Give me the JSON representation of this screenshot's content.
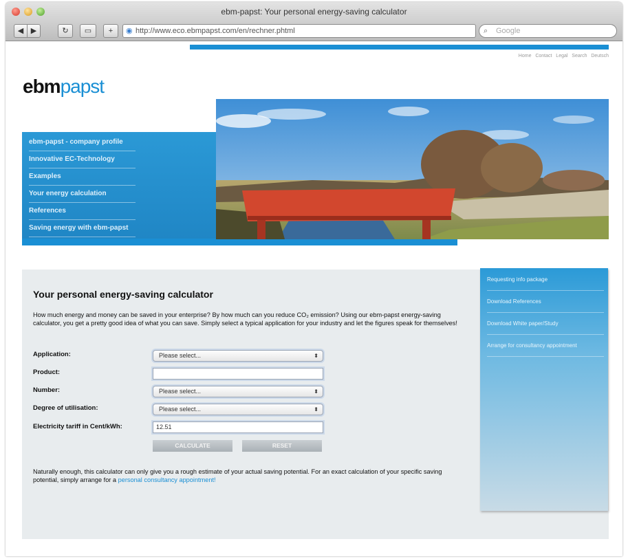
{
  "browser": {
    "title": "ebm-papst: Your personal energy-saving calculator",
    "url": "http://www.eco.ebmpapst.com/en/rechner.phtml",
    "search_placeholder": "Google",
    "back": "◀",
    "forward": "▶",
    "reload": "↻",
    "view": "▭",
    "add": "+",
    "url_icon": "globe-icon",
    "search_icon": "magnifier-icon"
  },
  "meta_links": [
    "Home",
    "Contact",
    "Legal",
    "Search",
    "Deutsch"
  ],
  "logo": {
    "part1": "ebm",
    "part2": "papst"
  },
  "nav": {
    "items": [
      "ebm-papst - company profile",
      "Innovative EC-Technology",
      "Examples",
      "Your energy calculation",
      "References",
      "Saving energy with ebm-papst"
    ]
  },
  "calculator": {
    "title": "Your personal energy-saving calculator",
    "intro": "How much energy and money can be saved in your enterprise? By how much can you reduce CO₂ emission? Using our ebm-papst energy-saving calculator, you get a pretty good idea of what you can save. Simply select a typical application for your industry and let the figures speak for themselves!",
    "fields": {
      "application": {
        "label": "Application:",
        "value": "Please select..."
      },
      "product": {
        "label": "Product:",
        "value": ""
      },
      "number": {
        "label": "Number:",
        "value": "Please select..."
      },
      "utilisation": {
        "label": "Degree of utilisation:",
        "value": "Please select..."
      },
      "tariff": {
        "label": "Electricity tariff in Cent/kWh:",
        "value": "12.51"
      }
    },
    "calculate_label": "CALCULATE",
    "reset_label": "RESET",
    "footnote_prefix": "Naturally enough, this calculator can only give you a rough estimate of your actual saving potential. For an exact calculation of your specific saving potential, simply arrange for a ",
    "footnote_link": "personal consultancy appointment!"
  },
  "side_panel": {
    "items": [
      "Requesting info package",
      "Download References",
      "Download White paper/Study",
      "Arrange for consultancy appointment"
    ]
  },
  "colors": {
    "brand_blue": "#1a8fd4",
    "button_grey": "#b4bbc0"
  }
}
